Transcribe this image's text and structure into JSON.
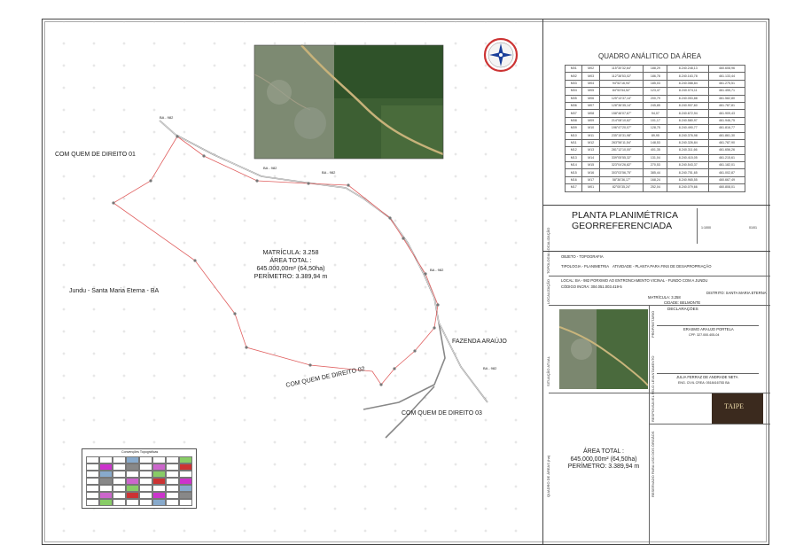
{
  "map": {
    "owner_labels": [
      "COM QUEM DE DIREITO 01",
      "COM QUEM DE DIREITO 02",
      "COM QUEM DE DIREITO 03"
    ],
    "place_left": "Jundu - Santa Maria Eterna - BA",
    "place_right": "FAZENDA ARAÚJO",
    "road_label": "BA - 982",
    "center_block": {
      "matricula": "MATRÍCULA: 3.258",
      "area_label": "ÁREA TOTAL :",
      "area_value": "645.000,00m² (64,50ha)",
      "perimetro": "PERÍMETRO: 3.389,94 m"
    },
    "legend_title": "Convenções Topográficas"
  },
  "quadro": {
    "title": "QUADRO ANÁLITICO DA ÁREA",
    "rows": [
      [
        "M01",
        "M02",
        "115°30'32,64\"",
        "188,29",
        "8.240.248,13",
        "460.608,96"
      ],
      [
        "M02",
        "M03",
        "112°38'53,02\"",
        "186,78",
        "8.240.163,78",
        "461.133,44"
      ],
      [
        "M03",
        "M04",
        "94°52'16,94\"",
        "185,03",
        "8.240.088,84",
        "461.275,51"
      ],
      [
        "M04",
        "M05",
        "84°53'54,52\"",
        "123,47",
        "8.240.074,11",
        "461.455,71"
      ],
      [
        "M05",
        "M06",
        "125°13'37,14\"",
        "200,79",
        "8.240.053,88",
        "461.582,80"
      ],
      [
        "M06",
        "M07",
        "128°36'35,14\"",
        "245,85",
        "8.240.907,60",
        "461.787,81"
      ],
      [
        "M07",
        "M08",
        "158°46'07,67\"",
        "94,07",
        "8.240.672,94",
        "461.909,43"
      ],
      [
        "M08",
        "M09",
        "214°08'10,62\"",
        "101,17",
        "8.240.580,97",
        "461.946,75"
      ],
      [
        "M09",
        "M10",
        "196°47'20,07\"",
        "128,75",
        "8.240.490,77",
        "461.816,77"
      ],
      [
        "M10",
        "M11",
        "235°15'31,98\"",
        "89,95",
        "8.240.376,98",
        "461.861,30"
      ],
      [
        "M11",
        "M12",
        "263°56'11,54\"",
        "148,53",
        "8.240.326,84",
        "461.787,90"
      ],
      [
        "M12",
        "M13",
        "281°12'10,00\"",
        "401,35",
        "8.240.311,66",
        "461.656,26"
      ],
      [
        "M13",
        "M14",
        "339°05'55,32\"",
        "131,04",
        "8.240.415,05",
        "461.215,61"
      ],
      [
        "M14",
        "M15",
        "323°04'26,82\"",
        "270,53",
        "8.240.543,37",
        "461.182,01"
      ],
      [
        "M15",
        "M16",
        "303°03'56,75\"",
        "385,44",
        "8.240.751,65",
        "461.002,87"
      ],
      [
        "M16",
        "M17",
        "58°36'36,17\"",
        "168,24",
        "8.240.965,55",
        "460.667,49"
      ],
      [
        "M17",
        "M01",
        "82°05'35,24\"",
        "252,04",
        "8.240.079,66",
        "460.808,01"
      ]
    ]
  },
  "title_block": {
    "title_line1": "PLANTA PLANIMÉTRICA",
    "title_line2": "GEORREFERENCIADA",
    "objeto": "OBJETO - TOPOGRAFIA",
    "tipologia": "TIPOLOGIA - PLANIMETRIA",
    "atividade": "ATIVIDADE - PLANTA PARA FINS DE DESAPROPRIAÇÃO",
    "local": "LOCAL: BA - 982 PORXIMO AO ENTRONCAMENTO VICINAL - FUNDO COM A JUNDU",
    "codigo": "CÓDIGO INCRA: 304.051.003.419-5",
    "matricula": "MATRÍCULA: 3.258",
    "distrito": "DISTRITO:  SANTA MARIA ETERNA",
    "cidade": "CIDADE: BELMONTE",
    "escala": "1:1000",
    "folha": "01/01",
    "declaracoes_title": "DECLARAÇÕES",
    "proprietario": "ERASMO ARAUJO PORTELA",
    "cpf": "CPF: 327.000.405-04",
    "responsavel": "JULIA FERRAZ DE ANDRADE NETA",
    "crea": "ENG. CIVIL CREA: 051841675D BA",
    "area_label": "ÁREA TOTAL :",
    "area_value": "645.000,00m² (64,50ha)",
    "perimetro": "PERÍMETRO: 3.389,94 m",
    "logo_text": "TAIPE",
    "vertical_labels": [
      "TOPOLOGIA LOCALIZAÇÃO",
      "LOCALIZAÇÃO",
      "SITUAÇÃO ATUAL",
      "QUADRO DE ÁREAS (ha)",
      "PROPRIETÁRIO",
      "RESPONSÁVEL PELO LEVANTAMENTO",
      "RESERVADO PARA USO DOS ÓRGÃOS"
    ]
  },
  "colors": {
    "boundary": "#e06060",
    "road": "#8a8a8a",
    "grid": "#cfcfcf"
  }
}
